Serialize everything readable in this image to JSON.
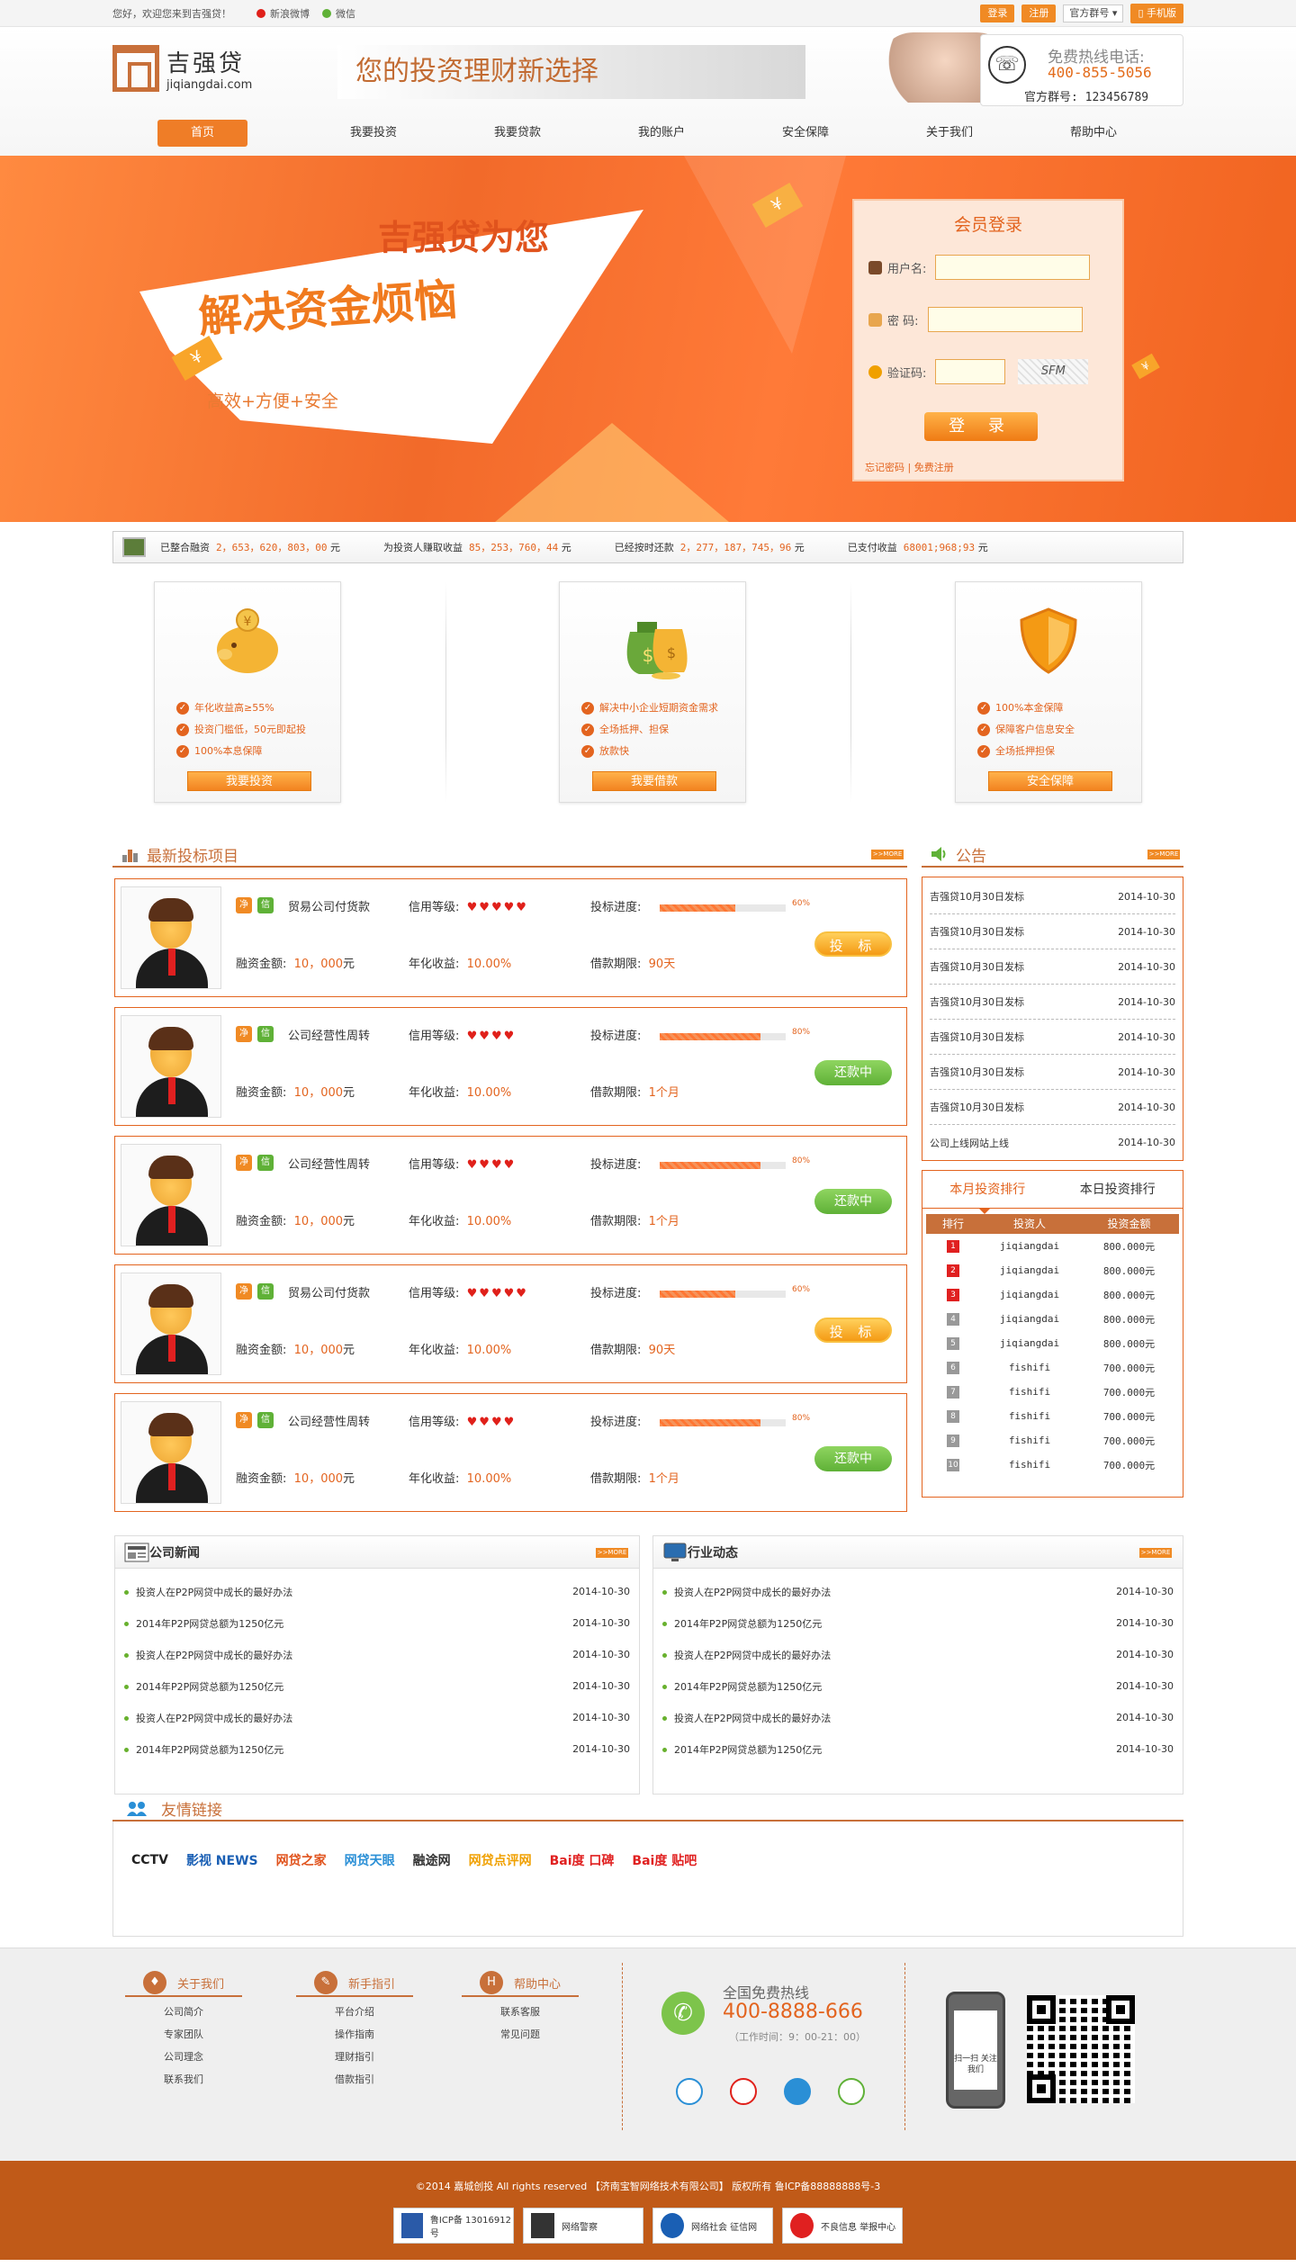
{
  "topbar": {
    "welcome": "您好，欢迎您来到吉强贷！",
    "weibo": "新浪微博",
    "wechat": "微信",
    "login": "登录",
    "register": "注册",
    "qq_group": "官方群号",
    "mobile": "手机版"
  },
  "header": {
    "logo_cn": "吉强贷",
    "logo_en": "jiqiangdai.com",
    "slogan": "您的投资理财新选择",
    "hotline_label": "免费热线电话:",
    "hotline_number": "400-855-5056",
    "group_label": "官方群号: 123456789"
  },
  "nav": [
    "首页",
    "我要投资",
    "我要贷款",
    "我的账户",
    "安全保障",
    "关于我们",
    "帮助中心"
  ],
  "banner": {
    "line1": "吉强贷为您",
    "line2": "解决资金烦恼",
    "line3": "高效+方便+安全",
    "yen": "¥"
  },
  "login": {
    "title": "会员登录",
    "username_label": "用户名:",
    "password_label": "密  码:",
    "captcha_label": "验证码:",
    "captcha_text": "SFM",
    "submit": "登  录",
    "forgot": "忘记密码",
    "signup": "免费注册"
  },
  "stats": [
    {
      "label": "已整合融资",
      "value": "2，653，620，803，00",
      "unit": "元"
    },
    {
      "label": "为投资人赚取收益",
      "value": "85，253，760，44",
      "unit": "元"
    },
    {
      "label": "已经按时还款",
      "value": "2，277，187，745，96",
      "unit": "元"
    },
    {
      "label": "已支付收益",
      "value": "68001;968;93",
      "unit": "元"
    }
  ],
  "features": [
    {
      "items": [
        "年化收益高≥55%",
        "投资门槛低，50元即起投",
        "100%本息保障"
      ],
      "button": "我要投资"
    },
    {
      "items": [
        "解决中小企业短期资金需求",
        "全场抵押、担保",
        "放款快"
      ],
      "button": "我要借款"
    },
    {
      "items": [
        "100%本金保障",
        "保障客户信息安全",
        "全场抵押担保"
      ],
      "button": "安全保障"
    }
  ],
  "projects_title": "最新投标项目",
  "more": ">>MORE",
  "project_labels": {
    "credit": "信用等级:",
    "progress": "投标进度:",
    "amount": "融资金额:",
    "rate": "年化收益:",
    "term": "借款期限:",
    "tag1": "净",
    "tag2": "信"
  },
  "projects": [
    {
      "name": "贸易公司付货款",
      "hearts": "♥♥♥♥♥",
      "progress": 60,
      "progress_text": "60%",
      "amount": "10，000",
      "amount_unit": "元",
      "rate": "10.00%",
      "term": "90天",
      "action": "投 标",
      "action_type": "inv"
    },
    {
      "name": "公司经营性周转",
      "hearts": "♥♥♥♥",
      "progress": 80,
      "progress_text": "80%",
      "amount": "10，000",
      "amount_unit": "元",
      "rate": "10.00%",
      "term": "1个月",
      "action": "还款中",
      "action_type": "rep"
    },
    {
      "name": "公司经营性周转",
      "hearts": "♥♥♥♥",
      "progress": 80,
      "progress_text": "80%",
      "amount": "10，000",
      "amount_unit": "元",
      "rate": "10.00%",
      "term": "1个月",
      "action": "还款中",
      "action_type": "rep"
    },
    {
      "name": "贸易公司付货款",
      "hearts": "♥♥♥♥♥",
      "progress": 60,
      "progress_text": "60%",
      "amount": "10，000",
      "amount_unit": "元",
      "rate": "10.00%",
      "term": "90天",
      "action": "投 标",
      "action_type": "inv"
    },
    {
      "name": "公司经营性周转",
      "hearts": "♥♥♥♥",
      "progress": 80,
      "progress_text": "80%",
      "amount": "10，000",
      "amount_unit": "元",
      "rate": "10.00%",
      "term": "1个月",
      "action": "还款中",
      "action_type": "rep"
    }
  ],
  "notice": {
    "title": "公告",
    "items": [
      {
        "text": "吉强贷10月30日发标",
        "date": "2014-10-30"
      },
      {
        "text": "吉强贷10月30日发标",
        "date": "2014-10-30"
      },
      {
        "text": "吉强贷10月30日发标",
        "date": "2014-10-30"
      },
      {
        "text": "吉强贷10月30日发标",
        "date": "2014-10-30"
      },
      {
        "text": "吉强贷10月30日发标",
        "date": "2014-10-30"
      },
      {
        "text": "吉强贷10月30日发标",
        "date": "2014-10-30"
      },
      {
        "text": "吉强贷10月30日发标",
        "date": "2014-10-30"
      },
      {
        "text": "公司上线网站上线",
        "date": "2014-10-30"
      }
    ]
  },
  "ranking": {
    "tab_month": "本月投资排行",
    "tab_day": "本日投资排行",
    "col_rank": "排行",
    "col_investor": "投资人",
    "col_amount": "投资金额",
    "rows": [
      {
        "rank": "1",
        "name": "jiqiangdai",
        "amount": "800.000元"
      },
      {
        "rank": "2",
        "name": "jiqiangdai",
        "amount": "800.000元"
      },
      {
        "rank": "3",
        "name": "jiqiangdai",
        "amount": "800.000元"
      },
      {
        "rank": "4",
        "name": "jiqiangdai",
        "amount": "800.000元"
      },
      {
        "rank": "5",
        "name": "jiqiangdai",
        "amount": "800.000元"
      },
      {
        "rank": "6",
        "name": "fishifi",
        "amount": "700.000元"
      },
      {
        "rank": "7",
        "name": "fishifi",
        "amount": "700.000元"
      },
      {
        "rank": "8",
        "name": "fishifi",
        "amount": "700.000元"
      },
      {
        "rank": "9",
        "name": "fishifi",
        "amount": "700.000元"
      },
      {
        "rank": "10",
        "name": "fishifi",
        "amount": "700.000元"
      }
    ]
  },
  "company_news": {
    "title": "公司新闻",
    "items": [
      {
        "text": "投资人在P2P网贷中成长的最好办法",
        "date": "2014-10-30"
      },
      {
        "text": "2014年P2P网贷总额为1250亿元",
        "date": "2014-10-30"
      },
      {
        "text": "投资人在P2P网贷中成长的最好办法",
        "date": "2014-10-30"
      },
      {
        "text": "2014年P2P网贷总额为1250亿元",
        "date": "2014-10-30"
      },
      {
        "text": "投资人在P2P网贷中成长的最好办法",
        "date": "2014-10-30"
      },
      {
        "text": "2014年P2P网贷总额为1250亿元",
        "date": "2014-10-30"
      }
    ]
  },
  "industry_news": {
    "title": "行业动态",
    "items": [
      {
        "text": "投资人在P2P网贷中成长的最好办法",
        "date": "2014-10-30"
      },
      {
        "text": "2014年P2P网贷总额为1250亿元",
        "date": "2014-10-30"
      },
      {
        "text": "投资人在P2P网贷中成长的最好办法",
        "date": "2014-10-30"
      },
      {
        "text": "2014年P2P网贷总额为1250亿元",
        "date": "2014-10-30"
      },
      {
        "text": "投资人在P2P网贷中成长的最好办法",
        "date": "2014-10-30"
      },
      {
        "text": "2014年P2P网贷总额为1250亿元",
        "date": "2014-10-30"
      }
    ]
  },
  "friend_links": {
    "title": "友情链接",
    "items": [
      {
        "text": "CCTV",
        "color": "#222222"
      },
      {
        "text": "影视 NEWS",
        "color": "#1a5fb4"
      },
      {
        "text": "网贷之家",
        "color": "#e0531d"
      },
      {
        "text": "网贷天眼",
        "color": "#2a8fd6"
      },
      {
        "text": "融途网",
        "color": "#333333"
      },
      {
        "text": "网贷点评网",
        "color": "#f0a000"
      },
      {
        "text": "Bai度 口碑",
        "color": "#e02020"
      },
      {
        "text": "Bai度 贴吧",
        "color": "#e02020"
      }
    ]
  },
  "footer": {
    "about": {
      "title": "关于我们",
      "icon": "♦",
      "items": [
        "公司简介",
        "专家团队",
        "公司理念",
        "联系我们"
      ]
    },
    "guide": {
      "title": "新手指引",
      "icon": "✎",
      "items": [
        "平台介绍",
        "操作指南",
        "理财指引",
        "借款指引"
      ]
    },
    "help": {
      "title": "帮助中心",
      "icon": "H",
      "items": [
        "联系客服",
        "常见问题"
      ]
    },
    "hotline_label": "全国免费热线",
    "hotline_number": "400-8888-666",
    "hours": "（工作时间：9：00-21：00）",
    "phone_text": "扫一扫 关注我们",
    "copyright": "©2014 嘉城创投 All rights reserved 【济南宝智网络技术有限公司】 版权所有 鲁ICP备88888888号-3",
    "badges": [
      "鲁ICP备 13016912号",
      "网络警察",
      "网络社会 征信网",
      "不良信息 举报中心"
    ]
  }
}
